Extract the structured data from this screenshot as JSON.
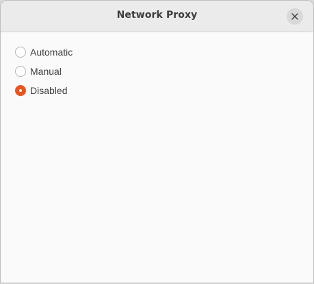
{
  "window": {
    "title": "Network Proxy"
  },
  "close_button": {
    "icon": "close-icon"
  },
  "proxy_options": [
    {
      "label": "Automatic",
      "checked": false
    },
    {
      "label": "Manual",
      "checked": false
    },
    {
      "label": "Disabled",
      "checked": true
    }
  ],
  "colors": {
    "accent": "#e95420",
    "titlebar": "#ebebeb",
    "background": "#fafafa",
    "text": "#3d3d3d"
  }
}
